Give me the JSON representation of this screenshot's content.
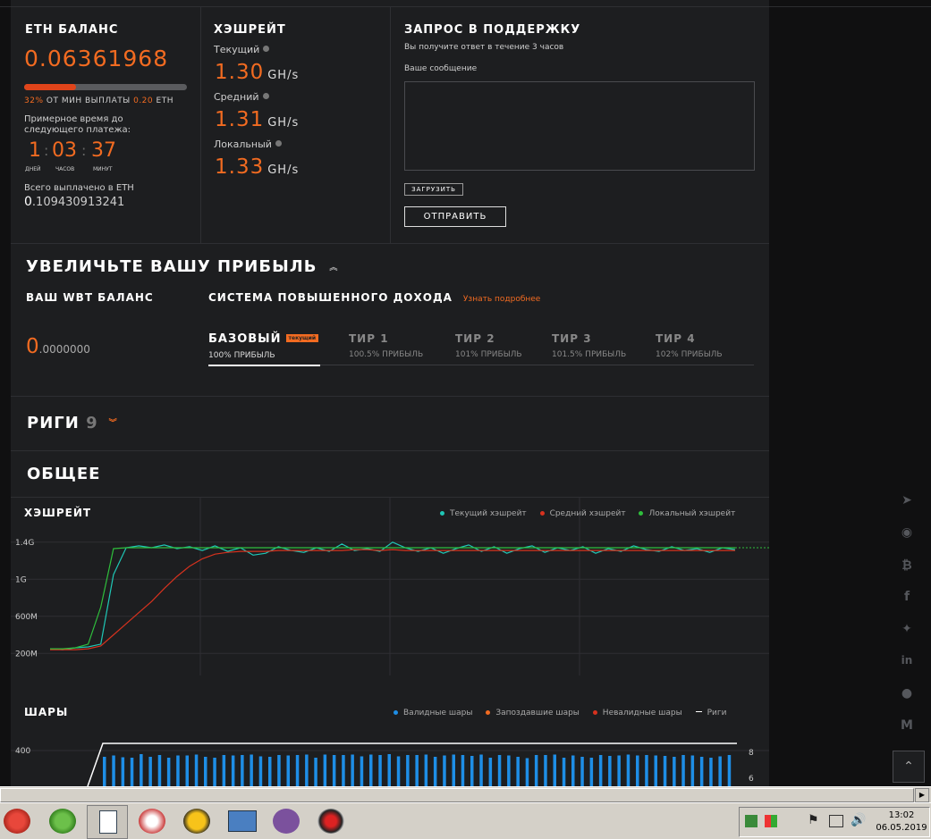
{
  "balance": {
    "title": "ETH БАЛАНС",
    "value": "0.06361968",
    "progress_fraction": 0.32,
    "progress_pct": "32%",
    "progress_text": "ОТ МИН ВЫПЛАТЫ",
    "min_payout": "0.20",
    "min_payout_unit": "ETH",
    "eta_label_line1": "Примерное время до",
    "eta_label_line2": "следующего платежа:",
    "eta_days": "1",
    "eta_hours": "03",
    "eta_minutes": "37",
    "eta_days_label": "ДНЕЙ",
    "eta_hours_label": "ЧАСОВ",
    "eta_minutes_label": "МИНУТ",
    "paid_label": "Всего выплачено в ETH",
    "paid_int": "0",
    "paid_frac": ".109430913241"
  },
  "hashrate": {
    "title": "ХЭШРЕЙТ",
    "current_label": "Текущий",
    "current_value": "1.30",
    "average_label": "Средний",
    "average_value": "1.31",
    "local_label": "Локальный",
    "local_value": "1.33",
    "unit": "GH/s"
  },
  "support": {
    "title": "ЗАПРОС В ПОДДЕРЖКУ",
    "subtitle": "Вы получите ответ в течение 3 часов",
    "message_label": "Ваше сообщение",
    "message_value": "",
    "upload_label": "ЗАГРУЗИТЬ",
    "send_label": "ОТПРАВИТЬ"
  },
  "profit": {
    "title": "УВЕЛИЧЬТЕ ВАШУ ПРИБЫЛЬ",
    "wbt_label": "ВАШ WBT БАЛАНС",
    "wbt_int": "0",
    "wbt_frac": ".0000000",
    "system_label": "СИСТЕМА ПОВЫШЕННОГО ДОХОДА",
    "learn_more": "Узнать подробнее",
    "tiers": [
      {
        "name": "БАЗОВЫЙ",
        "badge": "текущий",
        "profit": "100% ПРИБЫЛЬ"
      },
      {
        "name": "ТИР 1",
        "profit": "100.5% ПРИБЫЛЬ"
      },
      {
        "name": "ТИР 2",
        "profit": "101% ПРИБЫЛЬ"
      },
      {
        "name": "ТИР 3",
        "profit": "101.5% ПРИБЫЛЬ"
      },
      {
        "name": "ТИР 4",
        "profit": "102% ПРИБЫЛЬ"
      }
    ]
  },
  "rigs": {
    "title": "РИГИ",
    "count": "9"
  },
  "general": {
    "title": "ОБЩЕЕ"
  },
  "taskbar": {
    "time": "13:02",
    "date": "06.05.2019"
  },
  "chart_data": [
    {
      "type": "line",
      "title": "ХЭШРЕЙТ",
      "yticks": [
        "1.4G",
        "1G",
        "600M",
        "200M"
      ],
      "ytick_values": [
        1.4,
        1.0,
        0.6,
        0.2
      ],
      "ylim": [
        0.0,
        1.6
      ],
      "legend_placement": "top-right",
      "grid": true,
      "series": [
        {
          "name": "Текущий хэшрейт",
          "color": "#1fc7b6",
          "values": [
            0.25,
            0.24,
            0.26,
            0.27,
            0.3,
            1.05,
            1.34,
            1.36,
            1.34,
            1.37,
            1.33,
            1.35,
            1.31,
            1.36,
            1.3,
            1.34,
            1.26,
            1.28,
            1.35,
            1.31,
            1.29,
            1.34,
            1.3,
            1.38,
            1.31,
            1.33,
            1.3,
            1.4,
            1.34,
            1.3,
            1.34,
            1.28,
            1.33,
            1.37,
            1.3,
            1.35,
            1.28,
            1.33,
            1.36,
            1.29,
            1.34,
            1.31,
            1.35,
            1.28,
            1.33,
            1.3,
            1.36,
            1.32,
            1.3,
            1.35,
            1.31,
            1.33,
            1.29,
            1.34,
            1.32
          ]
        },
        {
          "name": "Средний хэшрейт",
          "color": "#d7321e",
          "values": [
            0.24,
            0.24,
            0.24,
            0.25,
            0.28,
            0.4,
            0.52,
            0.64,
            0.76,
            0.9,
            1.03,
            1.14,
            1.22,
            1.27,
            1.29,
            1.3,
            1.3,
            1.3,
            1.31,
            1.31,
            1.31,
            1.31,
            1.31,
            1.31,
            1.32,
            1.32,
            1.31,
            1.32,
            1.31,
            1.31,
            1.31,
            1.31,
            1.31,
            1.31,
            1.31,
            1.31,
            1.31,
            1.31,
            1.31,
            1.31,
            1.31,
            1.31,
            1.31,
            1.31,
            1.31,
            1.31,
            1.31,
            1.31,
            1.31,
            1.31,
            1.31,
            1.31,
            1.31,
            1.31,
            1.31
          ]
        },
        {
          "name": "Локальный хэшрейт",
          "color": "#2fbf3c",
          "values": [
            0.25,
            0.25,
            0.26,
            0.3,
            0.7,
            1.33,
            1.34,
            1.34,
            1.34,
            1.34,
            1.34,
            1.34,
            1.34,
            1.34,
            1.34,
            1.34,
            1.34,
            1.34,
            1.34,
            1.34,
            1.34,
            1.34,
            1.34,
            1.34,
            1.34,
            1.34,
            1.34,
            1.34,
            1.34,
            1.34,
            1.34,
            1.34,
            1.34,
            1.34,
            1.34,
            1.34,
            1.34,
            1.34,
            1.34,
            1.34,
            1.34,
            1.34,
            1.34,
            1.34,
            1.34,
            1.34,
            1.34,
            1.34,
            1.34,
            1.34,
            1.34,
            1.34,
            1.34,
            1.34,
            1.34
          ]
        }
      ]
    },
    {
      "type": "bar",
      "title": "ШАРЫ",
      "yticks_left": [
        "400"
      ],
      "yticks_right": [
        "8",
        "6"
      ],
      "legend_placement": "top-right",
      "series": [
        {
          "name": "Валидные шары",
          "color": "#1e8ee6",
          "values": [
            330,
            345,
            325,
            320,
            360,
            330,
            350,
            320,
            345,
            345,
            355,
            330,
            320,
            350,
            345,
            350,
            355,
            335,
            330,
            350,
            345,
            350,
            355,
            320,
            355,
            350,
            350,
            355,
            335,
            355,
            350,
            360,
            335,
            350,
            350,
            355,
            330,
            345,
            355,
            350,
            340,
            355,
            320,
            350,
            345,
            330,
            315,
            350,
            350,
            355,
            320,
            345,
            330,
            320,
            350,
            340,
            345,
            355,
            345,
            350,
            345,
            340,
            330,
            350,
            345,
            330,
            320,
            335,
            350
          ]
        },
        {
          "name": "Запоздавшие шары",
          "color": "#f26b21",
          "values": []
        },
        {
          "name": "Невалидные шары",
          "color": "#d7321e",
          "values": []
        },
        {
          "name": "Риги",
          "color": "#ffffff",
          "values": [
            9,
            9,
            9,
            9,
            9,
            9,
            9,
            9,
            9,
            9,
            9,
            9,
            9,
            9,
            9,
            9,
            9,
            9,
            9,
            9,
            9,
            9,
            9,
            9,
            9,
            9,
            9,
            9,
            9,
            9,
            9,
            9,
            9,
            9,
            9,
            9,
            9,
            9,
            9,
            9,
            9,
            9,
            9,
            9,
            9,
            9,
            9,
            9,
            9,
            9,
            9,
            9,
            9,
            9,
            9,
            9,
            9,
            9,
            9,
            9,
            9,
            9,
            9,
            9,
            9,
            9,
            9,
            9,
            9
          ]
        }
      ]
    }
  ]
}
